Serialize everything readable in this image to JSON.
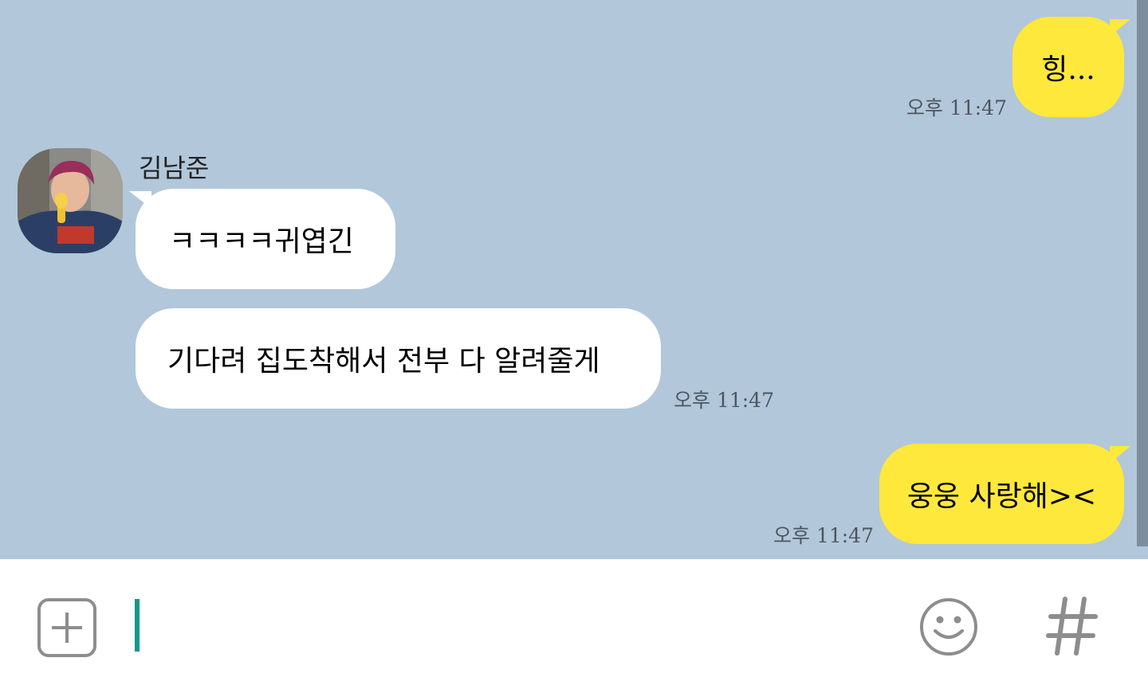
{
  "messages": [
    {
      "id": "m1",
      "direction": "outgoing",
      "text": "힝...",
      "time": "오후 11:47"
    },
    {
      "id": "m2",
      "direction": "incoming",
      "sender": "김남준",
      "text": "ㅋㅋㅋㅋ귀엽긴"
    },
    {
      "id": "m3",
      "direction": "incoming",
      "text": "기다려 집도착해서 전부 다 알려줄게",
      "time": "오후 11:47"
    },
    {
      "id": "m4",
      "direction": "outgoing",
      "text": "웅웅 사랑해><",
      "time": "오후 11:47"
    }
  ],
  "contact": {
    "name": "김남준",
    "avatar_icon": "profile-photo"
  },
  "input": {
    "value": "",
    "cursor_color": "#11988a"
  },
  "icons": {
    "attach": "plus-icon",
    "emoticon": "smiley-icon",
    "search": "hash-icon"
  },
  "colors": {
    "chat_background": "#b2c7da",
    "outgoing_bubble": "#fee83c",
    "incoming_bubble": "#ffffff"
  }
}
